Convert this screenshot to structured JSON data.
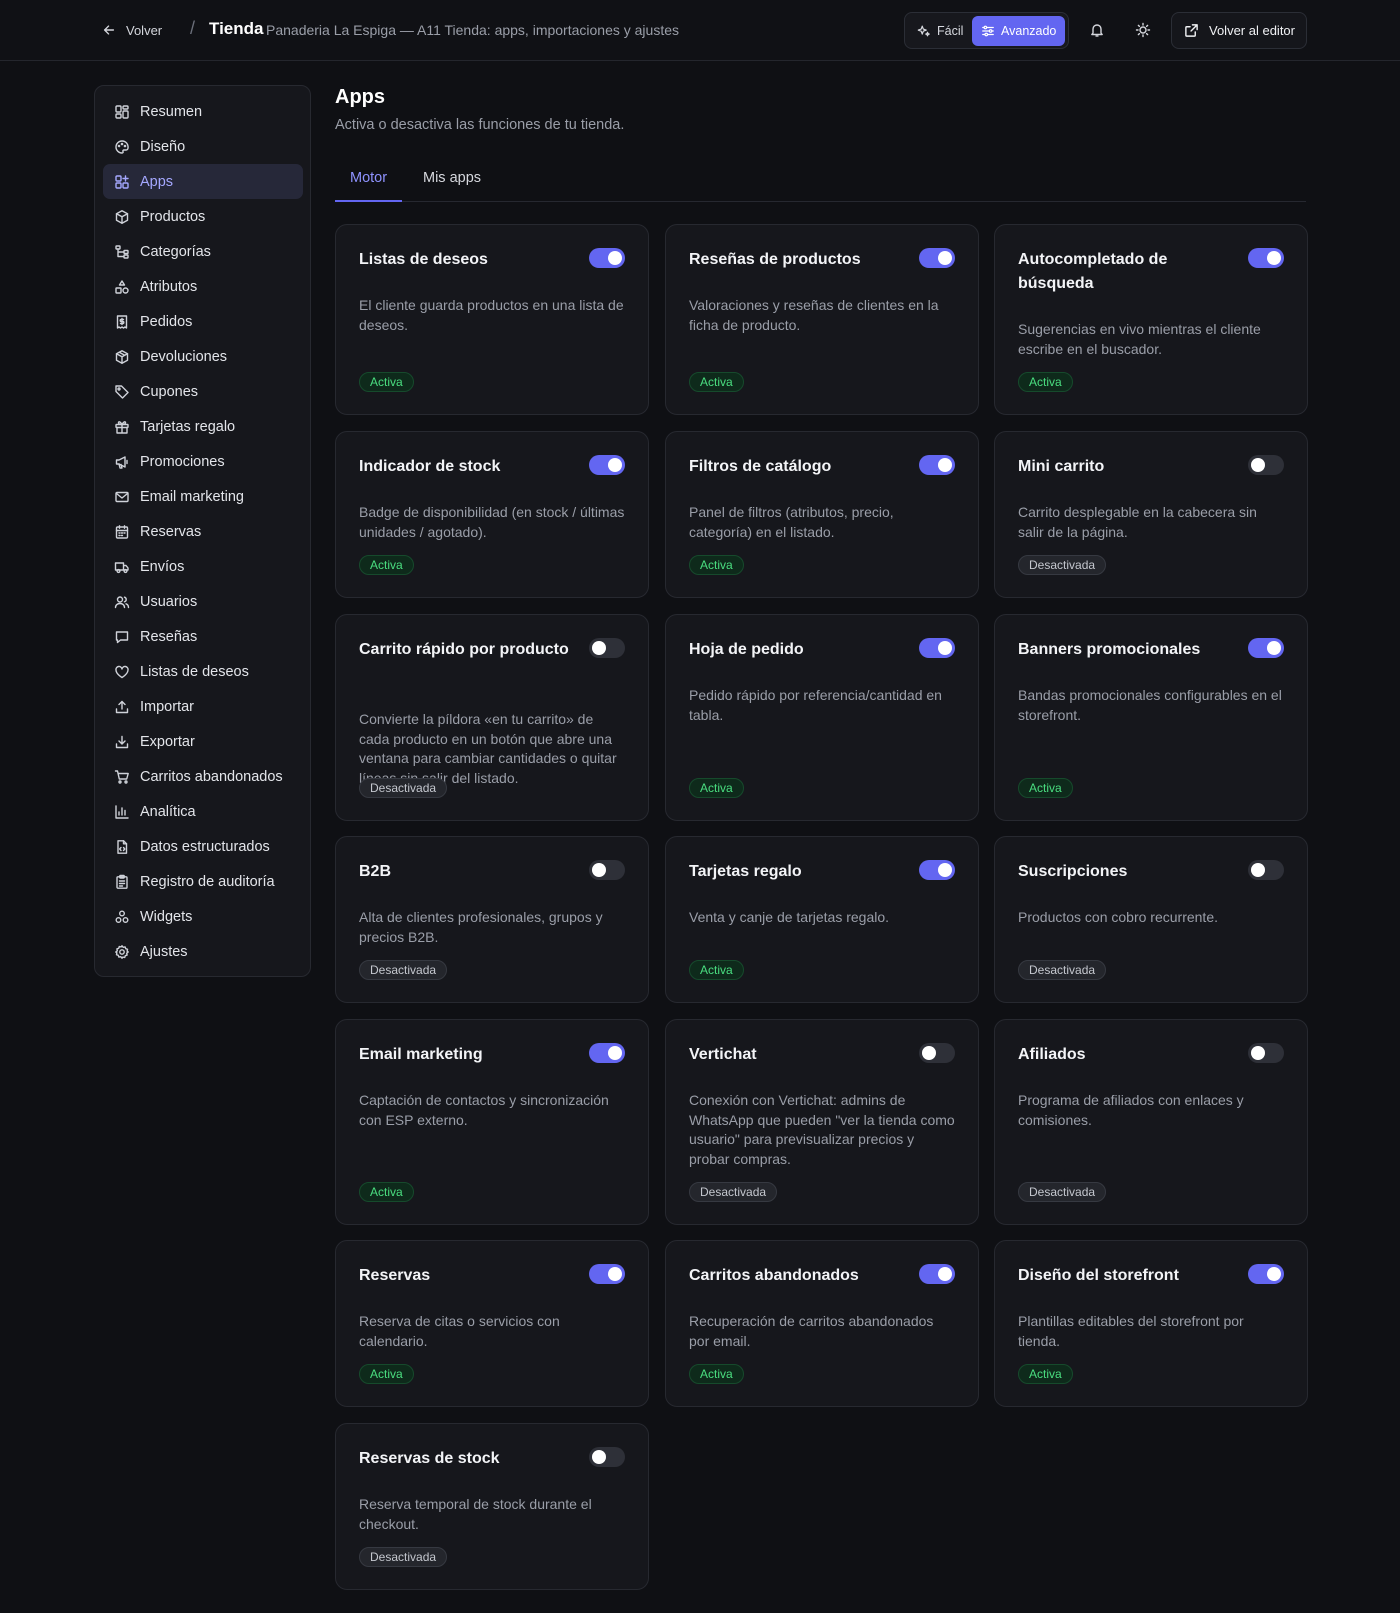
{
  "header": {
    "back_label": "Volver",
    "separator": "/",
    "section_title": "Tienda",
    "subtitle": "Panaderia La Espiga — A11 Tienda: apps, importaciones y ajustes",
    "mode_easy_label": "Fácil",
    "mode_advanced_label": "Avanzado",
    "active_mode": "Avanzado",
    "editor_button_label": "Volver al editor"
  },
  "sidebar": {
    "active": "Apps",
    "items": [
      {
        "label": "Resumen",
        "icon": "dashboard-icon"
      },
      {
        "label": "Diseño",
        "icon": "palette-icon"
      },
      {
        "label": "Apps",
        "icon": "apps-icon"
      },
      {
        "label": "Productos",
        "icon": "box-icon"
      },
      {
        "label": "Categorías",
        "icon": "tree-icon"
      },
      {
        "label": "Atributos",
        "icon": "shapes-icon"
      },
      {
        "label": "Pedidos",
        "icon": "receipt-icon"
      },
      {
        "label": "Devoluciones",
        "icon": "package-return-icon"
      },
      {
        "label": "Cupones",
        "icon": "tag-icon"
      },
      {
        "label": "Tarjetas regalo",
        "icon": "gift-icon"
      },
      {
        "label": "Promociones",
        "icon": "megaphone-icon"
      },
      {
        "label": "Email marketing",
        "icon": "mail-icon"
      },
      {
        "label": "Reservas",
        "icon": "calendar-icon"
      },
      {
        "label": "Envíos",
        "icon": "truck-icon"
      },
      {
        "label": "Usuarios",
        "icon": "users-icon"
      },
      {
        "label": "Reseñas",
        "icon": "message-icon"
      },
      {
        "label": "Listas de deseos",
        "icon": "heart-icon"
      },
      {
        "label": "Importar",
        "icon": "upload-icon"
      },
      {
        "label": "Exportar",
        "icon": "download-icon"
      },
      {
        "label": "Carritos abandonados",
        "icon": "cart-icon"
      },
      {
        "label": "Analítica",
        "icon": "bar-chart-icon"
      },
      {
        "label": "Datos estructurados",
        "icon": "file-code-icon"
      },
      {
        "label": "Registro de auditoría",
        "icon": "clipboard-icon"
      },
      {
        "label": "Widgets",
        "icon": "widgets-icon"
      },
      {
        "label": "Ajustes",
        "icon": "gear-icon"
      }
    ]
  },
  "main": {
    "title": "Apps",
    "subtitle": "Activa o desactiva las funciones de tu tienda.",
    "tabs": [
      {
        "label": "Motor",
        "active": true
      },
      {
        "label": "Mis apps",
        "active": false
      }
    ],
    "status_on_label": "Activa",
    "status_off_label": "Desactivada",
    "accent_color": "#6366f1",
    "active_badge_color": "#4ade80",
    "apps": [
      {
        "title": "Listas de deseos",
        "description": "El cliente guarda productos en una lista de deseos.",
        "enabled": true,
        "status": "Activa"
      },
      {
        "title": "Reseñas de productos",
        "description": "Valoraciones y reseñas de clientes en la ficha de producto.",
        "enabled": true,
        "status": "Activa"
      },
      {
        "title": "Autocompletado de búsqueda",
        "description": "Sugerencias en vivo mientras el cliente escribe en el buscador.",
        "enabled": true,
        "status": "Activa"
      },
      {
        "title": "Indicador de stock",
        "description": "Badge de disponibilidad (en stock / últimas unidades / agotado).",
        "enabled": true,
        "status": "Activa"
      },
      {
        "title": "Filtros de catálogo",
        "description": "Panel de filtros (atributos, precio, categoría) en el listado.",
        "enabled": true,
        "status": "Activa"
      },
      {
        "title": "Mini carrito",
        "description": "Carrito desplegable en la cabecera sin salir de la página.",
        "enabled": false,
        "status": "Desactivada"
      },
      {
        "title": "Carrito rápido por producto",
        "description": "Convierte la píldora «en tu carrito» de cada producto en un botón que abre una ventana para cambiar cantidades o quitar líneas sin salir del listado.",
        "enabled": false,
        "status": "Desactivada"
      },
      {
        "title": "Hoja de pedido",
        "description": "Pedido rápido por referencia/cantidad en tabla.",
        "enabled": true,
        "status": "Activa"
      },
      {
        "title": "Banners promocionales",
        "description": "Bandas promocionales configurables en el storefront.",
        "enabled": true,
        "status": "Activa"
      },
      {
        "title": "B2B",
        "description": "Alta de clientes profesionales, grupos y precios B2B.",
        "enabled": false,
        "status": "Desactivada"
      },
      {
        "title": "Tarjetas regalo",
        "description": "Venta y canje de tarjetas regalo.",
        "enabled": true,
        "status": "Activa"
      },
      {
        "title": "Suscripciones",
        "description": "Productos con cobro recurrente.",
        "enabled": false,
        "status": "Desactivada"
      },
      {
        "title": "Email marketing",
        "description": "Captación de contactos y sincronización con ESP externo.",
        "enabled": true,
        "status": "Activa"
      },
      {
        "title": "Vertichat",
        "description": "Conexión con Vertichat: admins de WhatsApp que pueden \"ver la tienda como usuario\" para previsualizar precios y probar compras.",
        "enabled": false,
        "status": "Desactivada"
      },
      {
        "title": "Afiliados",
        "description": "Programa de afiliados con enlaces y comisiones.",
        "enabled": false,
        "status": "Desactivada"
      },
      {
        "title": "Reservas",
        "description": "Reserva de citas o servicios con calendario.",
        "enabled": true,
        "status": "Activa"
      },
      {
        "title": "Carritos abandonados",
        "description": "Recuperación de carritos abandonados por email.",
        "enabled": true,
        "status": "Activa"
      },
      {
        "title": "Diseño del storefront",
        "description": "Plantillas editables del storefront por tienda.",
        "enabled": true,
        "status": "Activa"
      },
      {
        "title": "Reservas de stock",
        "description": "Reserva temporal de stock durante el checkout.",
        "enabled": false,
        "status": "Desactivada"
      }
    ]
  }
}
